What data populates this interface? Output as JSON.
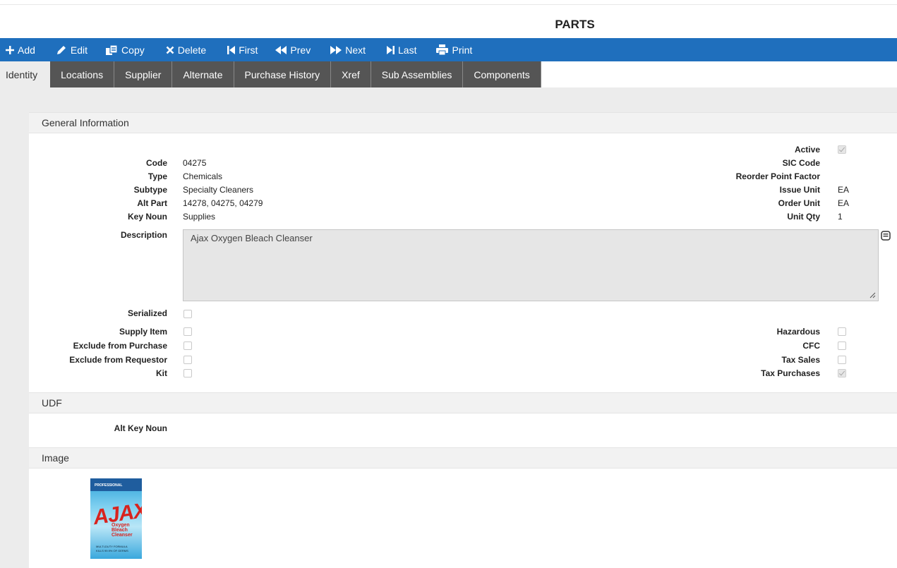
{
  "page": {
    "title": "PARTS"
  },
  "toolbar": {
    "add": "Add",
    "edit": "Edit",
    "copy": "Copy",
    "delete": "Delete",
    "first": "First",
    "prev": "Prev",
    "next": "Next",
    "last": "Last",
    "print": "Print"
  },
  "tabs": [
    "Identity",
    "Locations",
    "Supplier",
    "Alternate",
    "Purchase History",
    "Xref",
    "Sub Assemblies",
    "Components"
  ],
  "general": {
    "heading": "General Information",
    "code_label": "Code",
    "code": "04275",
    "type_label": "Type",
    "type": "Chemicals",
    "subtype_label": "Subtype",
    "subtype": "Specialty Cleaners",
    "altpart_label": "Alt Part",
    "altpart": "14278, 04275, 04279",
    "keynoun_label": "Key Noun",
    "keynoun": "Supplies",
    "active_label": "Active",
    "active": true,
    "sic_label": "SIC Code",
    "sic": "",
    "reorder_label": "Reorder Point Factor",
    "reorder": "",
    "issueunit_label": "Issue Unit",
    "issueunit": "EA",
    "orderunit_label": "Order Unit",
    "orderunit": "EA",
    "unitqty_label": "Unit Qty",
    "unitqty": "1",
    "description_label": "Description",
    "description": "Ajax Oxygen Bleach Cleanser",
    "serialized_label": "Serialized",
    "serialized": false,
    "supply_label": "Supply Item",
    "supply": false,
    "exclpurch_label": "Exclude from Purchase",
    "exclpurch": false,
    "exclreq_label": "Exclude from Requestor",
    "exclreq": false,
    "kit_label": "Kit",
    "kit": false,
    "hazardous_label": "Hazardous",
    "hazardous": false,
    "cfc_label": "CFC",
    "cfc": false,
    "taxsales_label": "Tax Sales",
    "taxsales": false,
    "taxpurch_label": "Tax Purchases",
    "taxpurch": true
  },
  "udf": {
    "heading": "UDF",
    "altkeynoun_label": "Alt Key Noun",
    "altkeynoun": ""
  },
  "image": {
    "heading": "Image",
    "product": {
      "brand_top": "PROFESSIONAL",
      "logo": "AJAX",
      "sub1": "Oxygen Bleach",
      "sub2": "Cleanser",
      "foot1": "MULTI-DUTY FORMULA",
      "foot2": "KILLS 99.9% OF GERMS"
    }
  },
  "colors": {
    "toolbar": "#1f6fbd",
    "tab_inactive": "#555555",
    "tab_active": "#ececec"
  }
}
